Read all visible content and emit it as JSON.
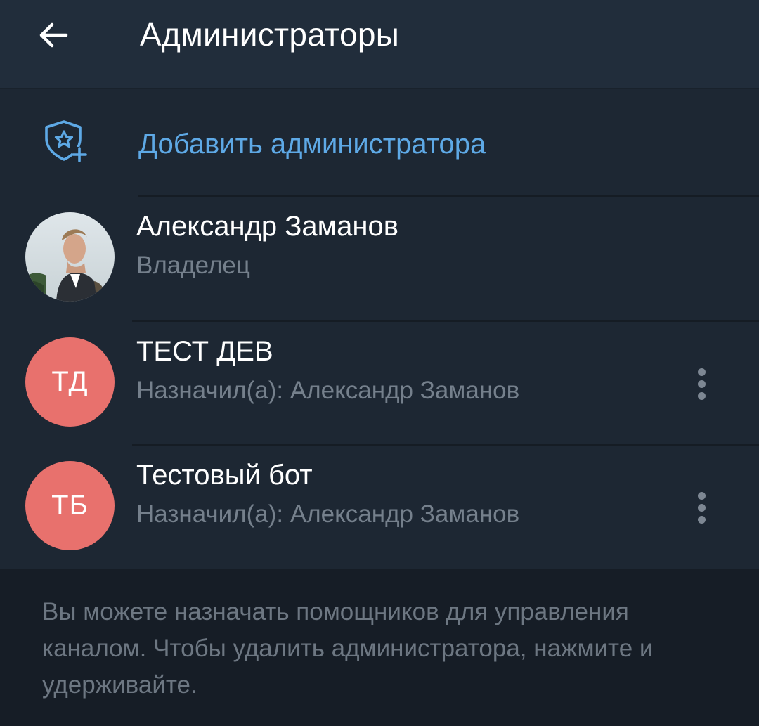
{
  "header": {
    "title": "Администраторы",
    "back_icon": "arrow-left-icon"
  },
  "add_admin": {
    "label": "Добавить администратора",
    "icon": "shield-star-plus-icon",
    "accent_color": "#5ea9e6"
  },
  "admins": [
    {
      "name": "Александр Заманов",
      "subtitle": "Владелец",
      "avatar_type": "photo",
      "has_menu": false
    },
    {
      "name": "ТЕСТ ДЕВ",
      "subtitle": "Назначил(а): Александр Заманов",
      "avatar_type": "initials",
      "initials": "ТД",
      "avatar_color": "#e8716d",
      "has_menu": true
    },
    {
      "name": "Тестовый бот",
      "subtitle": "Назначил(а): Александр Заманов",
      "avatar_type": "initials",
      "initials": "ТБ",
      "avatar_color": "#e8716d",
      "has_menu": true
    }
  ],
  "footer": {
    "note": "Вы можете назначать помощников для управления каналом. Чтобы удалить администратора, нажмите и удерживайте."
  }
}
